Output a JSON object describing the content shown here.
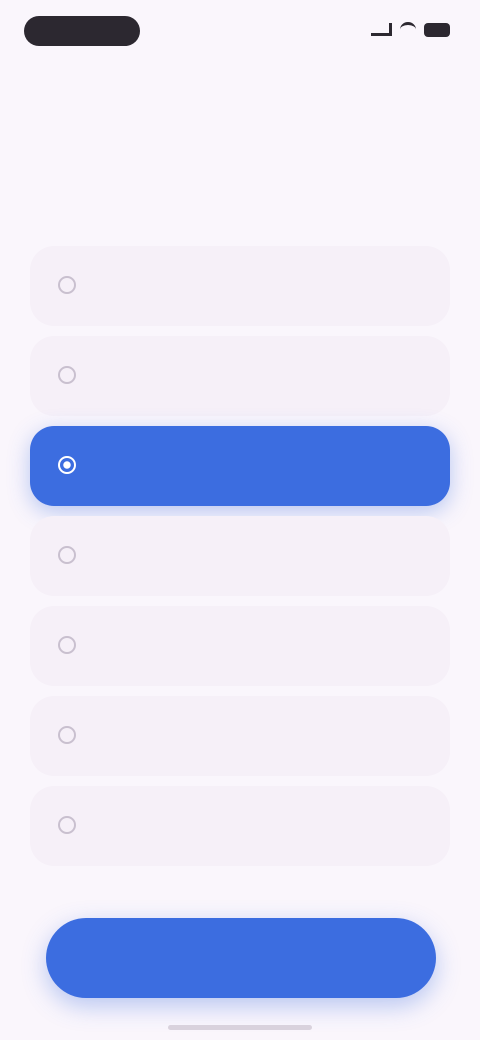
{
  "status_bar": {
    "time": ""
  },
  "header": {
    "step_label": "",
    "title": "",
    "subtitle": ""
  },
  "options": [
    {
      "label": "",
      "selected": false
    },
    {
      "label": "",
      "selected": false
    },
    {
      "label": "",
      "selected": true
    },
    {
      "label": "",
      "selected": false
    },
    {
      "label": "",
      "selected": false
    },
    {
      "label": "",
      "selected": false
    },
    {
      "label": "",
      "selected": false
    }
  ],
  "footer": {
    "continue_label": ""
  },
  "colors": {
    "accent": "#3c6de0",
    "background": "#faf6fc",
    "option_background": "#f6f0f8",
    "step_label": "#5a5fe0"
  },
  "icons": {
    "signal": "signal-icon",
    "wifi": "wifi-icon",
    "battery": "battery-icon",
    "option_radio": "radio-icon"
  }
}
